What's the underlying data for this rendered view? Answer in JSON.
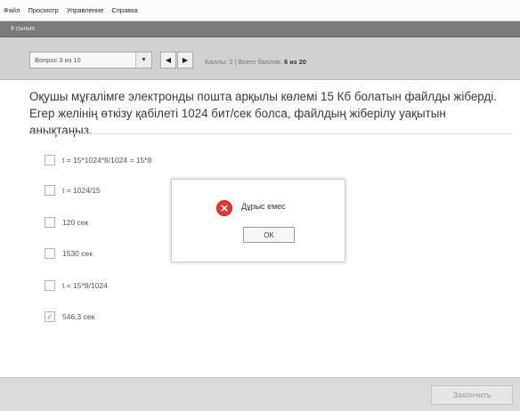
{
  "menu": {
    "items": [
      "Файл",
      "Просмотр",
      "Управление",
      "Справка"
    ]
  },
  "window": {
    "title": "8 сынып"
  },
  "toolbar": {
    "question_select_value": "Вопрос 3 из 10",
    "score_label": "Баллы: 2",
    "score_separator": "|",
    "total_label": "Всего баллов:",
    "total_value": "6 из 20"
  },
  "question": {
    "text": "Оқушы мұғалімге электронды пошта арқылы көлемі 15 Кб болатын файлды жіберді. Егер желінің өткізу қабілеті 1024 бит/сек болса, файлдың жіберілу уақытын анықтаңыз."
  },
  "answers": [
    {
      "label": "t = 15*1024*8/1024 = 15*8",
      "checked": false
    },
    {
      "label": "t = 1024/15",
      "checked": false
    },
    {
      "label": "120 сек",
      "checked": false
    },
    {
      "label": "1530 сек",
      "checked": false
    },
    {
      "label": "t = 15*8/1024",
      "checked": false
    },
    {
      "label": "546,3 сек",
      "checked": true
    }
  ],
  "dialog": {
    "message": "Дұрыс емес",
    "ok_label": "OK",
    "icon": "error-icon"
  },
  "footer": {
    "finish_label": "Закончить"
  }
}
